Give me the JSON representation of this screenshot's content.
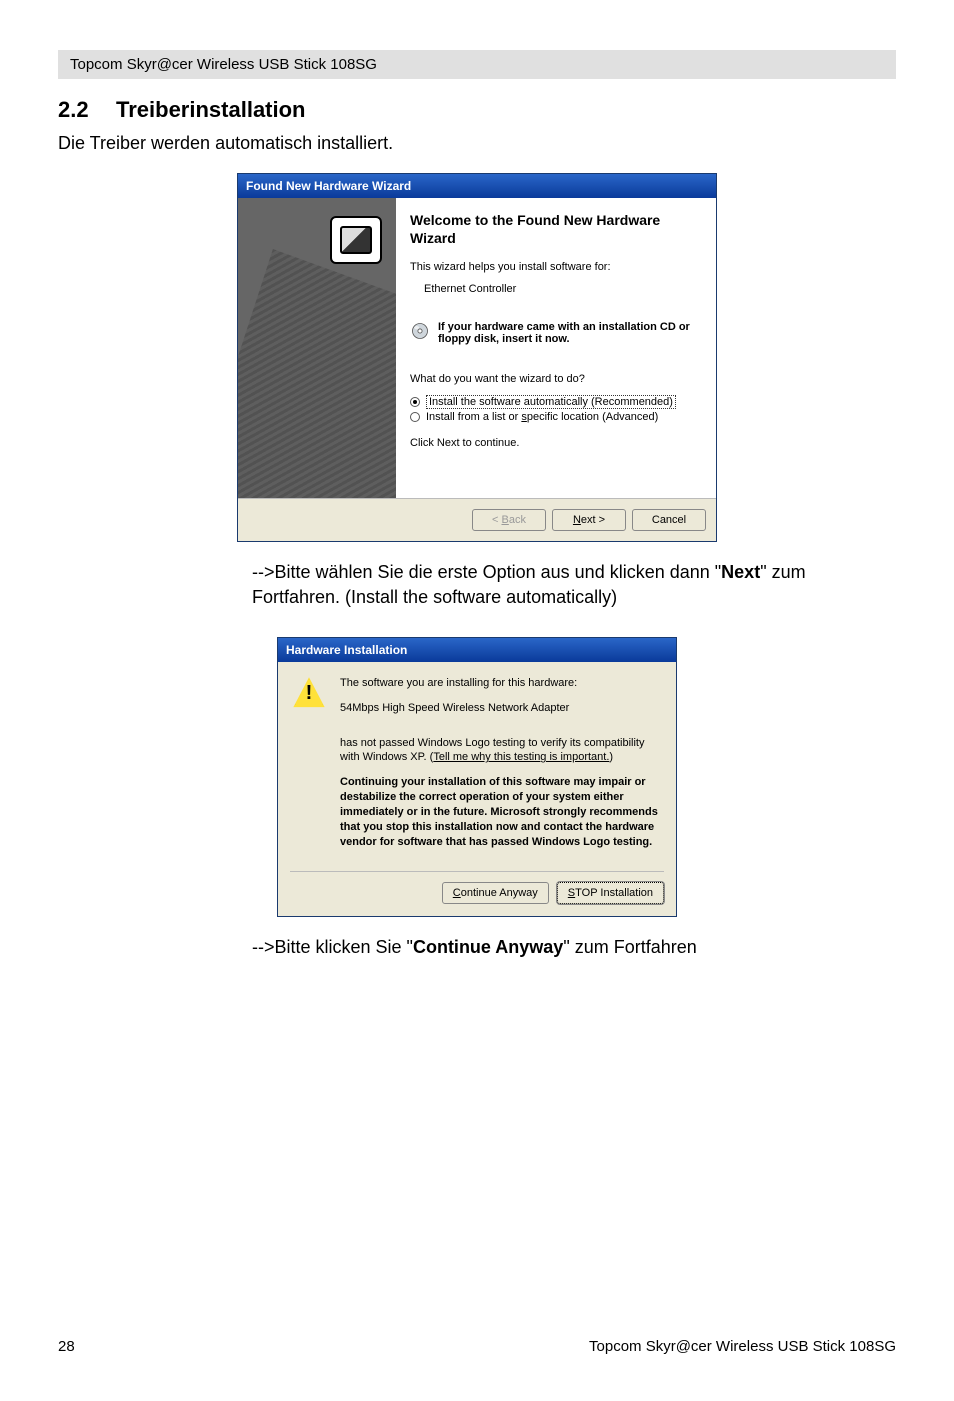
{
  "doc": {
    "header": "Topcom Skyr@cer Wireless USB Stick 108SG",
    "section_number": "2.2",
    "section_title": "Treiberinstallation",
    "intro": "Die Treiber werden automatisch installiert.",
    "instruction1_prefix": "-->Bitte wählen Sie die erste Option aus und klicken dann \"",
    "instruction1_bold": "Next",
    "instruction1_suffix": "\" zum Fortfahren. (Install the software automatically)",
    "instruction2_prefix": "-->Bitte klicken Sie \"",
    "instruction2_bold": "Continue Anyway",
    "instruction2_suffix": "\" zum Fortfahren",
    "page_number": "28",
    "footer_right": "Topcom Skyr@cer Wireless USB Stick 108SG"
  },
  "wizard": {
    "title": "Found New Hardware Wizard",
    "heading": "Welcome to the Found New Hardware Wizard",
    "helps_text": "This wizard helps you install software for:",
    "device": "Ethernet Controller",
    "tip": "If your hardware came with an installation CD or floppy disk, insert it now.",
    "question": "What do you want the wizard to do?",
    "opt1_pre": "Install the software automatically (Recommended)",
    "opt2_pre": "Install from a list or ",
    "opt2_u": "s",
    "opt2_post": "pecific location (Advanced)",
    "continue_text": "Click Next to continue.",
    "btn_back_pre": "< ",
    "btn_back_u": "B",
    "btn_back_post": "ack",
    "btn_next_u": "N",
    "btn_next_post": "ext >",
    "btn_cancel": "Cancel"
  },
  "hw": {
    "title": "Hardware Installation",
    "line1": "The software you are installing for this hardware:",
    "device": "54Mbps High Speed Wireless Network Adapter",
    "line2a": "has not passed Windows Logo testing to verify its compatibility with Windows XP. (",
    "line2_link": "Tell me why this testing is important.",
    "line2b": ")",
    "bold_para": "Continuing your installation of this software may impair or destabilize the correct operation of your system either immediately or in the future. Microsoft strongly recommends that you stop this installation now and contact the hardware vendor for software that has passed Windows Logo testing.",
    "btn_continue_u": "C",
    "btn_continue_post": "ontinue Anyway",
    "btn_stop_u": "S",
    "btn_stop_post": "TOP Installation"
  }
}
